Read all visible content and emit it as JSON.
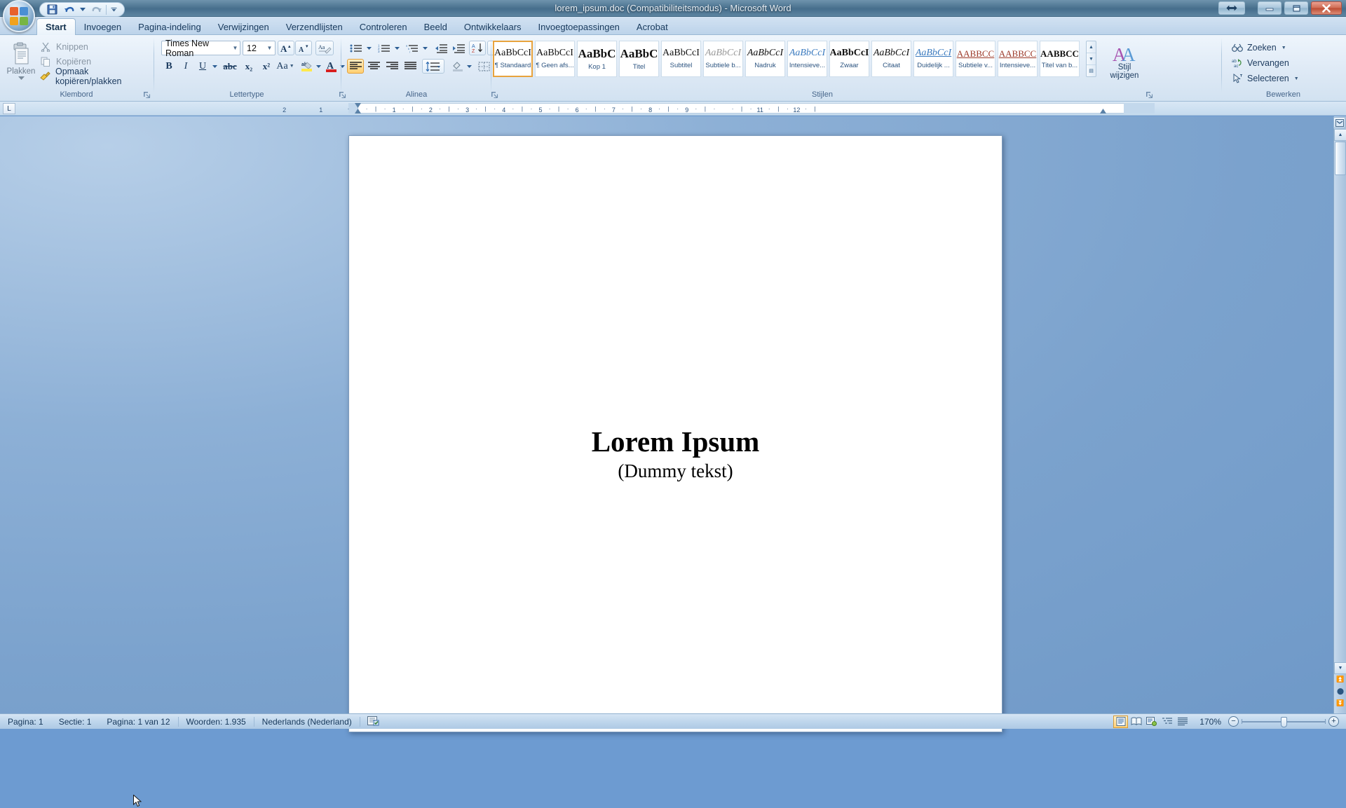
{
  "window": {
    "title": "lorem_ipsum.doc (Compatibiliteitsmodus) - Microsoft Word",
    "restore_icon": "restore-window-icon",
    "minimize_label": "–",
    "maximize_label": "❐",
    "close_label": "✕"
  },
  "quick_access": {
    "save": "Opslaan",
    "undo": "Ongedaan maken",
    "redo": "Opnieuw",
    "customize": "Werkbalk Snelle toegang aanpassen"
  },
  "tabs": [
    {
      "label": "Start",
      "active": true
    },
    {
      "label": "Invoegen",
      "active": false
    },
    {
      "label": "Pagina-indeling",
      "active": false
    },
    {
      "label": "Verwijzingen",
      "active": false
    },
    {
      "label": "Verzendlijsten",
      "active": false
    },
    {
      "label": "Controleren",
      "active": false
    },
    {
      "label": "Beeld",
      "active": false
    },
    {
      "label": "Ontwikkelaars",
      "active": false
    },
    {
      "label": "Invoegtoepassingen",
      "active": false
    },
    {
      "label": "Acrobat",
      "active": false
    }
  ],
  "ribbon": {
    "clipboard": {
      "group_label": "Klembord",
      "paste_label": "Plakken",
      "items": [
        {
          "label": "Knippen",
          "icon": "scissors-icon",
          "enabled": false
        },
        {
          "label": "Kopiëren",
          "icon": "copy-icon",
          "enabled": false
        },
        {
          "label": "Opmaak kopiëren/plakken",
          "icon": "format-painter-icon",
          "enabled": true
        }
      ]
    },
    "font": {
      "group_label": "Lettertype",
      "font_name": "Times New Roman",
      "font_size": "12",
      "grow_label": "A",
      "shrink_label": "A",
      "clear_format": "Opmaak wissen",
      "bold": "B",
      "italic": "I",
      "underline": "U",
      "strikethrough": "abc",
      "subscript": "x₂",
      "superscript": "x²",
      "change_case": "Aa",
      "highlight": "ab",
      "font_color": "A"
    },
    "paragraph": {
      "group_label": "Alinea",
      "bullets": "Opsommingstekens",
      "numbering": "Nummering",
      "multilevel": "Lijst met meerdere niveaus",
      "decrease_indent": "Inspringing verkleinen",
      "increase_indent": "Inspringing vergroten",
      "sort": "Sorteren",
      "show_marks": "¶",
      "align_left": "Links uitlijnen",
      "align_center": "Centreren",
      "align_right": "Rechts uitlijnen",
      "justify": "Uitvullen",
      "line_spacing": "Regelafstand",
      "shading": "Arcering",
      "borders": "Randen"
    },
    "styles": {
      "group_label": "Stijlen",
      "change_styles_label": "Stijl\nwijzigen",
      "change_styles_line1": "Stijl",
      "change_styles_line2": "wijzigen",
      "items": [
        {
          "sample": "AaBbCcI",
          "name": "¶ Standaard",
          "selected": true,
          "style": "normal"
        },
        {
          "sample": "AaBbCcI",
          "name": "¶ Geen afs...",
          "selected": false,
          "style": "normal"
        },
        {
          "sample": "AaBbC",
          "name": "Kop 1",
          "selected": false,
          "style": "bold-big"
        },
        {
          "sample": "AaBbC",
          "name": "Titel",
          "selected": false,
          "style": "bold-big"
        },
        {
          "sample": "AaBbCcI",
          "name": "Subtitel",
          "selected": false,
          "style": "normal"
        },
        {
          "sample": "AaBbCcI",
          "name": "Subtiele b...",
          "selected": false,
          "style": "italic-gray"
        },
        {
          "sample": "AaBbCcI",
          "name": "Nadruk",
          "selected": false,
          "style": "italic"
        },
        {
          "sample": "AaBbCcI",
          "name": "Intensieve...",
          "selected": false,
          "style": "italic-blue"
        },
        {
          "sample": "AaBbCcI",
          "name": "Zwaar",
          "selected": false,
          "style": "bold"
        },
        {
          "sample": "AaBbCcI",
          "name": "Citaat",
          "selected": false,
          "style": "italic"
        },
        {
          "sample": "AaBbCcI",
          "name": "Duidelijk ...",
          "selected": false,
          "style": "italic-blue-underline"
        },
        {
          "sample": "AABBCC",
          "name": "Subtiele v...",
          "selected": false,
          "style": "smallcaps-red-underline"
        },
        {
          "sample": "AABBCC",
          "name": "Intensieve...",
          "selected": false,
          "style": "smallcaps-red-underline"
        },
        {
          "sample": "AABBCC",
          "name": "Titel van b...",
          "selected": false,
          "style": "smallcaps-bold"
        }
      ]
    },
    "editing": {
      "group_label": "Bewerken",
      "items": [
        {
          "label": "Zoeken",
          "icon": "binoculars-icon",
          "has_arrow": true
        },
        {
          "label": "Vervangen",
          "icon": "replace-icon",
          "has_arrow": false
        },
        {
          "label": "Selecteren",
          "icon": "select-pointer-icon",
          "has_arrow": true
        }
      ]
    }
  },
  "ruler": {
    "tab_stop_label": "L",
    "left_ticks": [
      "2",
      "1"
    ],
    "ticks": [
      "1",
      "2",
      "3",
      "4",
      "5",
      "6",
      "7",
      "8",
      "9",
      "11",
      "12"
    ]
  },
  "document": {
    "title": "Lorem Ipsum",
    "subtitle": "(Dummy tekst)"
  },
  "status_bar": {
    "page": "Pagina: 1",
    "section": "Sectie: 1",
    "page_of": "Pagina: 1 van 12",
    "words": "Woorden: 1.935",
    "language": "Nederlands (Nederland)",
    "proofing_icon": "spell-check-icon",
    "views": [
      {
        "name": "print-layout-view",
        "selected": true
      },
      {
        "name": "full-screen-reading-view",
        "selected": false
      },
      {
        "name": "web-layout-view",
        "selected": false
      },
      {
        "name": "outline-view",
        "selected": false
      },
      {
        "name": "draft-view",
        "selected": false
      }
    ],
    "zoom": "170%",
    "zoom_out": "−",
    "zoom_in": "+"
  },
  "colors": {
    "accent": "#e8a33d",
    "titlebar": "#4d7491",
    "ribbon_bg": "#dfeaf6",
    "text_blue": "#16375a",
    "close_red": "#bc4c33"
  }
}
